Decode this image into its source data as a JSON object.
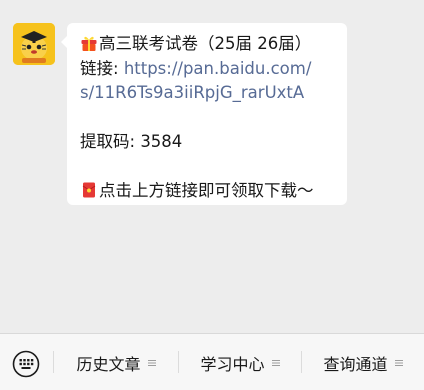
{
  "message": {
    "line1_text": "高三联考试卷（25届 26届）",
    "link_label": "链接: ",
    "link_part1": "https://pan.baidu.com/",
    "link_part2": "s/11R6Ts9a3iiRpjG_rarUxtA",
    "code_label": "提取码: ",
    "code_value": "3584",
    "cta_text": "点击上方链接即可领取下载～",
    "line1_icon": "gift-icon",
    "cta_icon": "red-envelope-icon"
  },
  "tabbar": {
    "keyboard_icon": "keyboard-icon",
    "tabs": [
      {
        "label": "历史文章"
      },
      {
        "label": "学习中心"
      },
      {
        "label": "查询通道"
      }
    ]
  },
  "colors": {
    "background": "#ededed",
    "bubble": "#ffffff",
    "link": "#576b95",
    "avatar": "#f6c21c"
  }
}
